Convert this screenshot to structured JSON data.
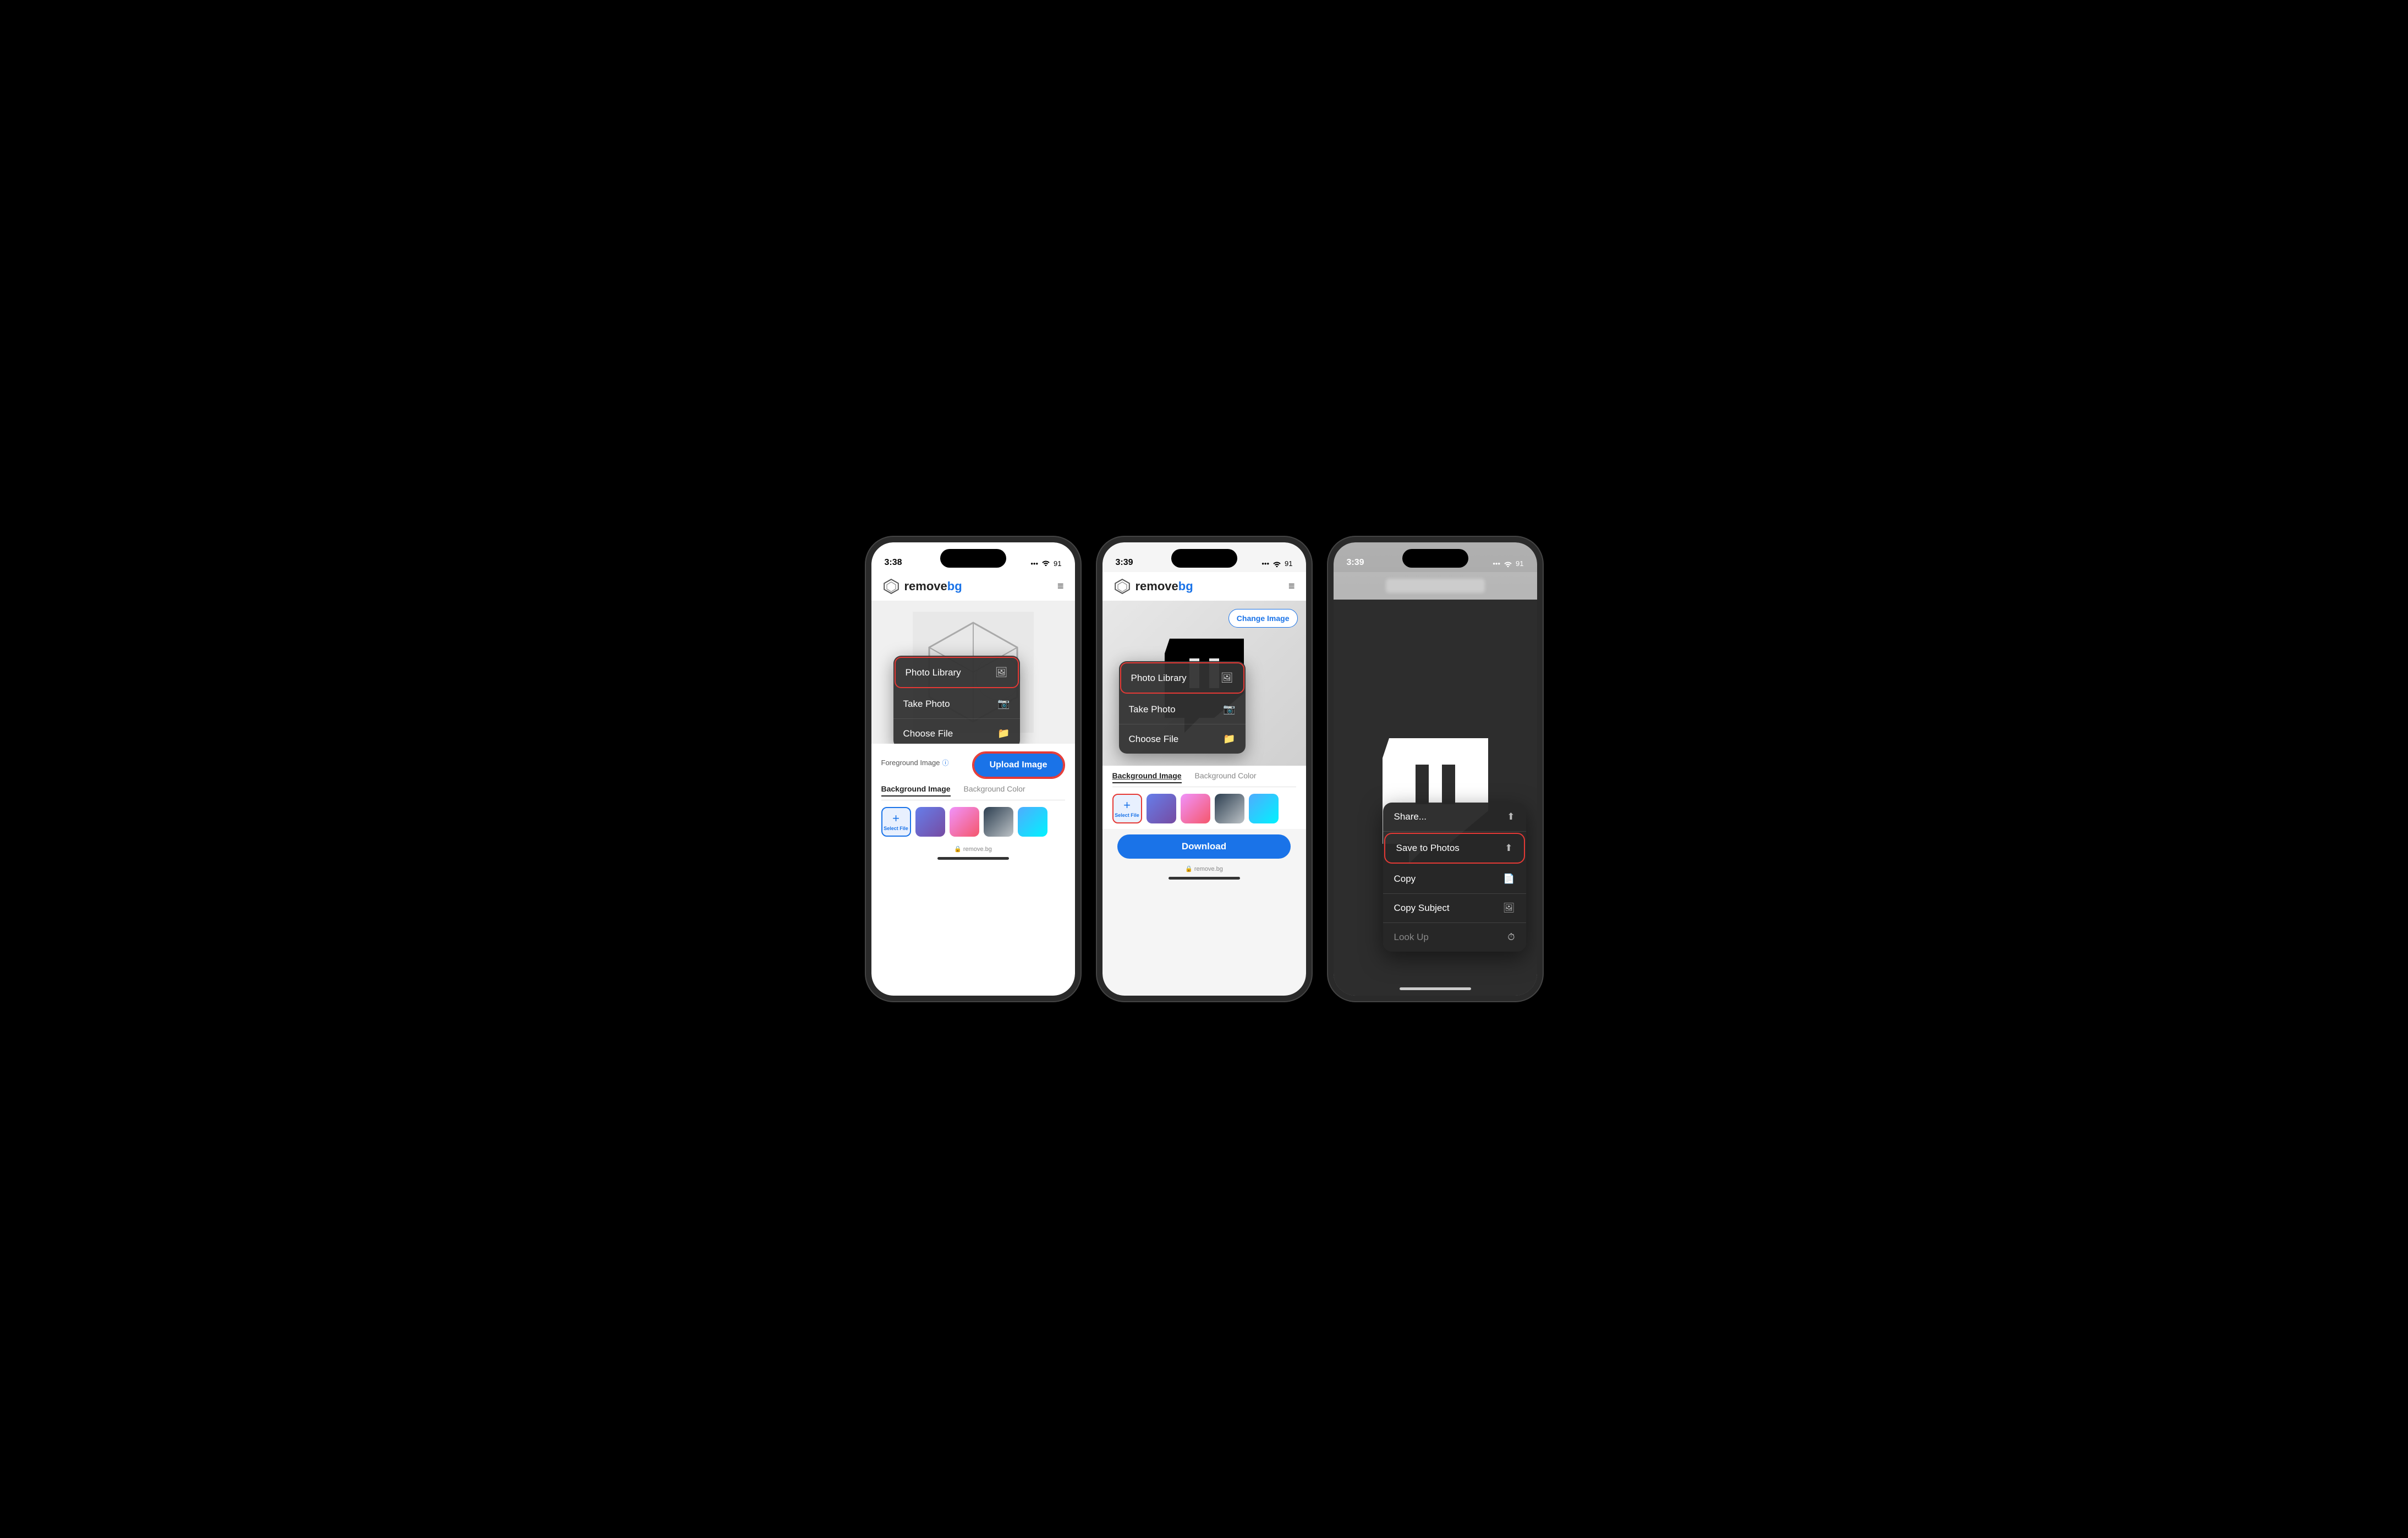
{
  "phone1": {
    "statusBar": {
      "time": "3:38",
      "signal": "...",
      "wifi": "WiFi",
      "battery": "91"
    },
    "logo": {
      "name": "remove",
      "accent": "bg",
      "fullText": "remove"
    },
    "dropdown": {
      "items": [
        {
          "label": "Photo Library",
          "icon": "🖼️",
          "highlighted": true
        },
        {
          "label": "Take Photo",
          "icon": "📷",
          "highlighted": false
        },
        {
          "label": "Choose File",
          "icon": "📁",
          "highlighted": false
        }
      ]
    },
    "foregroundLabel": "Foreground Image",
    "uploadBtn": "Upload Image",
    "tabs": [
      "Background Image",
      "Background Color"
    ],
    "selectFile": "Select File",
    "urlBar": "🔒 remove.bg"
  },
  "phone2": {
    "statusBar": {
      "time": "3:39",
      "battery": "91"
    },
    "dropdown": {
      "items": [
        {
          "label": "Photo Library",
          "icon": "🖼️",
          "highlighted": true
        },
        {
          "label": "Take Photo",
          "icon": "📷",
          "highlighted": false
        },
        {
          "label": "Choose File",
          "icon": "📁",
          "highlighted": false
        }
      ]
    },
    "changeImage": "Change Image",
    "tabs": [
      "Background Image",
      "Background Color"
    ],
    "selectFile": "Select File",
    "downloadBtn": "Download",
    "urlBar": "🔒 remove.bg"
  },
  "phone3": {
    "statusBar": {
      "time": "3:39",
      "battery": "91"
    },
    "contextMenu": {
      "items": [
        {
          "label": "Share...",
          "icon": "⬆️",
          "highlighted": false,
          "dimmed": false
        },
        {
          "label": "Save to Photos",
          "icon": "⬆️",
          "highlighted": true,
          "dimmed": false
        },
        {
          "label": "Copy",
          "icon": "📄",
          "highlighted": false,
          "dimmed": false
        },
        {
          "label": "Copy Subject",
          "icon": "🖼️",
          "highlighted": false,
          "dimmed": false
        },
        {
          "label": "Look Up",
          "icon": "⏱️",
          "highlighted": false,
          "dimmed": true
        }
      ]
    }
  }
}
